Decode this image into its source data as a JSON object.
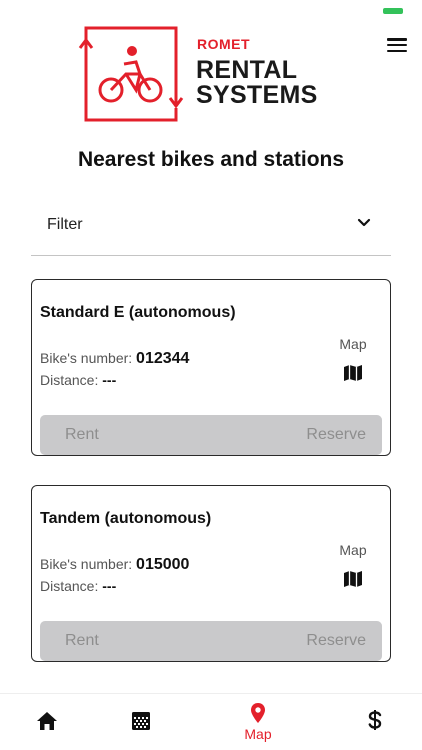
{
  "brand": {
    "small": "ROMET",
    "line1": "RENTAL",
    "line2": "SYSTEMS",
    "accent": "#e3202b"
  },
  "page_title": "Nearest bikes and stations",
  "filter": {
    "label": "Filter"
  },
  "cards": [
    {
      "title": "Standard E (autonomous)",
      "number_label": "Bike's number:",
      "number": "012344",
      "distance_label": "Distance:",
      "distance": "---",
      "map_label": "Map",
      "rent": "Rent",
      "reserve": "Reserve"
    },
    {
      "title": "Tandem (autonomous)",
      "number_label": "Bike's number:",
      "number": "015000",
      "distance_label": "Distance:",
      "distance": "---",
      "map_label": "Map",
      "rent": "Rent",
      "reserve": "Reserve"
    }
  ],
  "tabbar": {
    "active": "map",
    "map_label": "Map",
    "icons": [
      "home-icon",
      "calendar-icon",
      "map-pin-icon",
      "dollar-icon"
    ]
  }
}
